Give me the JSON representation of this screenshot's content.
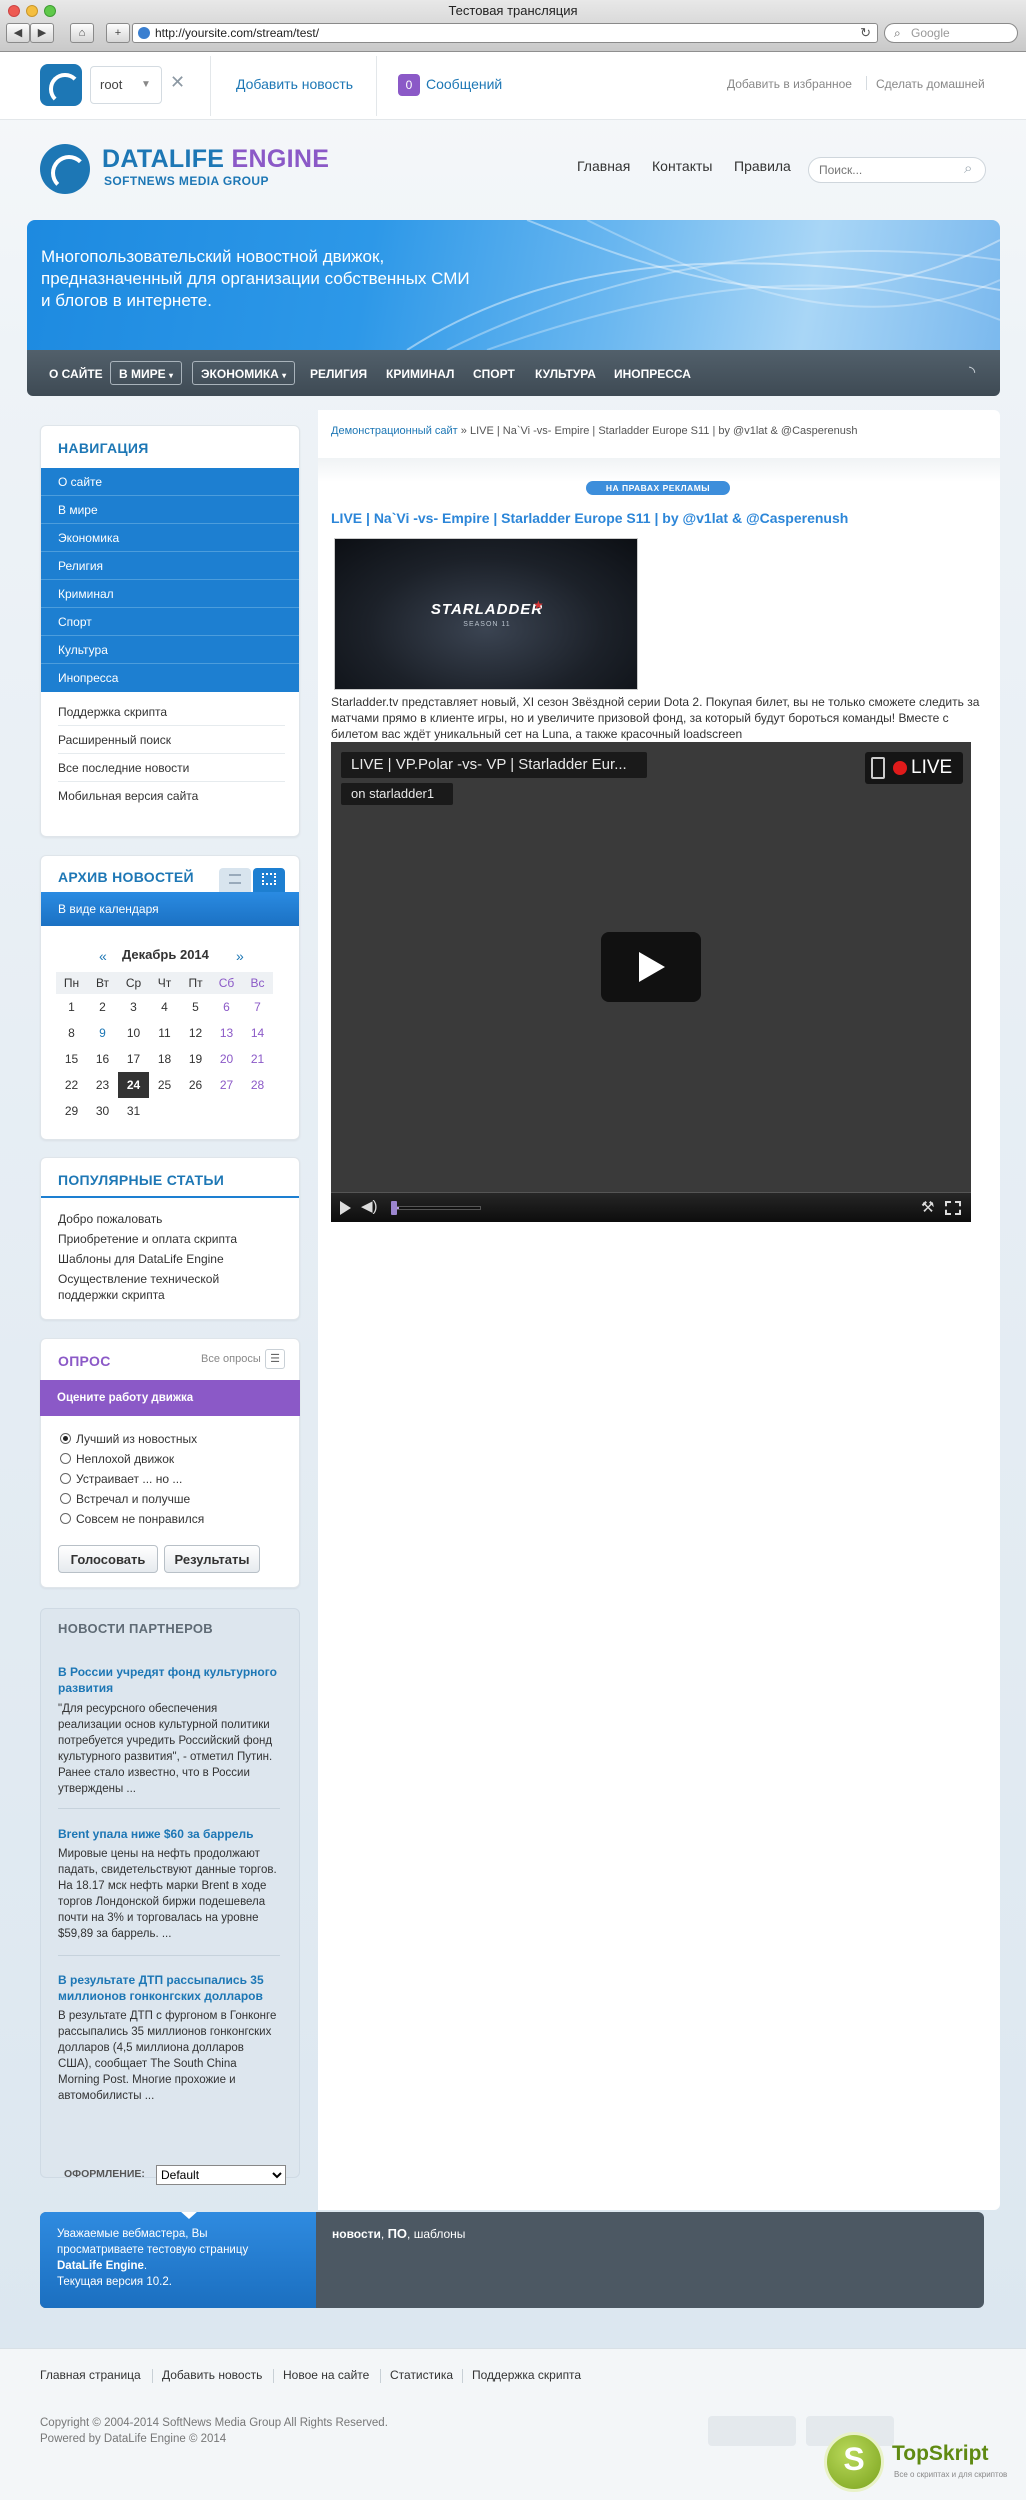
{
  "window": {
    "title": "Тестовая трансляция",
    "url": "http://yoursite.com/stream/test/",
    "search_placeholder": "Google"
  },
  "topbar": {
    "user": "root",
    "add_news": "Добавить новость",
    "messages_count": "0",
    "messages": "Сообщений",
    "favorites": "Добавить в избранное",
    "homepage": "Сделать домашней"
  },
  "header": {
    "brand_a": "DATALIFE",
    "brand_b": "ENGINE",
    "brand_sub": "SOFTNEWS MEDIA GROUP",
    "nav": [
      "Главная",
      "Контакты",
      "Правила"
    ],
    "search_placeholder": "Поиск..."
  },
  "banner": {
    "text": "Многопользовательский новостной движок, предназначенный для организации собственных СМИ и блогов в интернете."
  },
  "mainnav": [
    "О САЙТЕ",
    "В МИРЕ",
    "ЭКОНОМИКА",
    "РЕЛИГИЯ",
    "КРИМИНАЛ",
    "СПОРТ",
    "КУЛЬТУРА",
    "ИНОПРЕССА"
  ],
  "sidebar": {
    "nav_title": "НАВИГАЦИЯ",
    "nav_items": [
      "О сайте",
      "В мире",
      "Экономика",
      "Религия",
      "Криминал",
      "Спорт",
      "Культура",
      "Инопресса"
    ],
    "nav_items2": [
      "Поддержка скрипта",
      "Расширенный поиск",
      "Все последние новости",
      "Мобильная версия сайта"
    ],
    "archive_title": "АРХИВ НОВОСТЕЙ",
    "archive_bar": "В виде календаря",
    "calendar": {
      "prev": "«",
      "month": "Декабрь 2014",
      "next": "»",
      "days": [
        "Пн",
        "Вт",
        "Ср",
        "Чт",
        "Пт",
        "Сб",
        "Вс"
      ],
      "weeks": [
        [
          "1",
          "2",
          "3",
          "4",
          "5",
          "6",
          "7"
        ],
        [
          "8",
          "9",
          "10",
          "11",
          "12",
          "13",
          "14"
        ],
        [
          "15",
          "16",
          "17",
          "18",
          "19",
          "20",
          "21"
        ],
        [
          "22",
          "23",
          "24",
          "25",
          "26",
          "27",
          "28"
        ],
        [
          "29",
          "30",
          "31",
          "",
          "",
          "",
          ""
        ]
      ]
    },
    "popular_title": "ПОПУЛЯРНЫЕ СТАТЬИ",
    "popular": [
      "Добро пожаловать",
      "Приобретение и оплата скрипта",
      "Шаблоны для DataLife Engine",
      "Осуществление технической поддержки скрипта"
    ],
    "poll_title": "ОПРОС",
    "poll_all": "Все опросы",
    "poll_question": "Оцените работу движка",
    "poll_options": [
      "Лучший из новостных",
      "Неплохой движок",
      "Устраивает ... но ...",
      "Встречал и получше",
      "Совсем не понравился"
    ],
    "vote": "Голосовать",
    "results": "Результаты",
    "partners_title": "НОВОСТИ ПАРТНЕРОВ",
    "partners": [
      {
        "title": "В России учредят фонд культурного развития",
        "body": "\"Для ресурсного обеспечения реализации основ культурной политики потребуется учредить Российский фонд культурного развития\", - отметил Путин. Ранее стало известно, что в России утверждены ..."
      },
      {
        "title": "Brent упала ниже $60 за баррель",
        "body": "Мировые цены на нефть продолжают падать, свидетельствуют данные торгов. На 18.17 мск нефть марки Brent в ходе торгов Лондонской биржи подешевела почти на 3% и торговалась на уровне $59,89 за баррель. ..."
      },
      {
        "title": "В результате ДТП рассыпались 35 миллионов гонконгских долларов",
        "body": "В результате ДТП с фургоном в Гонконге рассыпались 35 миллионов гонконгских долларов (4,5 миллиона долларов США), сообщает The South China Morning Post. Многие прохожие и автомобилисты ..."
      }
    ],
    "skin_label": "ОФОРМЛЕНИЕ:",
    "skin_value": "Default"
  },
  "content": {
    "breadcrumb_link": "Демонстрационный сайт",
    "breadcrumb_rest": " » LIVE | Na`Vi -vs- Empire | Starladder Europe S11 | by @v1lat & @Casperenush",
    "ad_label": "НА ПРАВАХ РЕКЛАМЫ",
    "title": "LIVE | Na`Vi -vs- Empire | Starladder Europe S11 | by @v1lat & @Casperenush",
    "image_logo": "STARLADDER",
    "image_sub": "SEASON 11",
    "text": "Starladder.tv представляет новый, XI сезон Звёздной серии Dota 2. Покупая билет, вы не только сможете следить за матчами прямо в клиенте игры, но и увеличите призовой фонд, за который будут бороться команды! Вместе с билетом вас ждёт уникальный сет на Luna, а также красочный loadscreen",
    "video_title": "LIVE | VP.Polar -vs- VP | Starladder Eur...",
    "video_channel": "on starladder1",
    "video_live": "LIVE",
    "progress": 0.06
  },
  "bottom": {
    "notice_a": "Уважаемые вебмастера, Вы просматриваете тестовую страницу ",
    "notice_b": "DataLife Engine",
    "notice_c": ".",
    "notice_version": "Текущая версия 10.2.",
    "tags_a": "новости",
    "tags_b": ", ",
    "tags_c": "ПО",
    "tags_d": ", шаблоны"
  },
  "footer": {
    "nav": [
      "Главная страница",
      "Добавить новость",
      "Новое на сайте",
      "Статистика",
      "Поддержка скрипта"
    ],
    "copyright": "Copyright © 2004-2014 SoftNews Media Group All Rights Reserved.",
    "powered": "Powered by DataLife Engine © 2014"
  },
  "watermark": {
    "letter": "S",
    "name": "TopSkript",
    "slogan": "Все о скриптах и для скриптов"
  }
}
